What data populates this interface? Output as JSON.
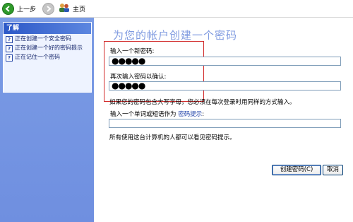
{
  "toolbar": {
    "back_label": "上一步",
    "home_label": "主页"
  },
  "sidebar": {
    "heading": "了解",
    "items": [
      "正在创建一个安全密码",
      "正在创建一个好的密码提示",
      "正在记住一个密码"
    ]
  },
  "main": {
    "title": "为您的帐户创建一个密码",
    "new_password_label": "输入一个新密码:",
    "new_password_value": "●●●●●",
    "confirm_password_label": "再次输入密码以确认:",
    "confirm_password_value": "●●●●●",
    "case_note": "如果您的密码包含大写字母，您必须在每次登录时用同样的方式输入。",
    "hint_label_prefix": "输入一个单词或短语作为",
    "hint_link": "密码提示",
    "hint_colon": ":",
    "hint_value": "",
    "hint_note": "所有使用这台计算机的人都可以看见密码提示。"
  },
  "buttons": {
    "create": "创建密码(C)",
    "cancel": "取消"
  },
  "colors": {
    "sidebar": "#7b9ce5",
    "title": "#7f9ae0",
    "highlight_border": "#d22c2c",
    "back_icon": "#2f9a2b"
  }
}
